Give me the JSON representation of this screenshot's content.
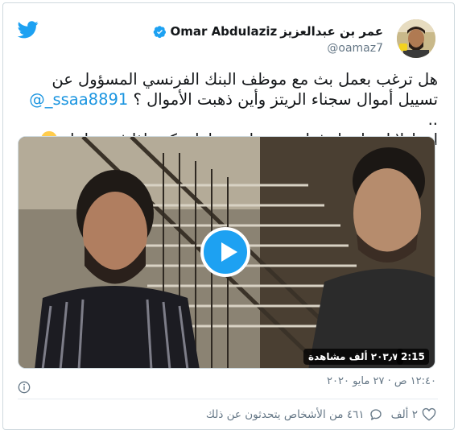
{
  "header": {
    "display_name_ar": "عمر بن عبدالعزيز",
    "display_name_en": "Omar Abdulaziz",
    "handle": "@oamaz7",
    "verified": true,
    "brand_icon": "twitter-bird-icon",
    "brand_color": "#1da1f2"
  },
  "tweet": {
    "line1": "هل ترغب بعمل بث مع موظف البنك الفرنسي المسؤول عن",
    "line2_text": "تسييل أموال سجناء الريتز وأين ذهبت الأموال ؟",
    "line2_mention": "@_ssaa8891",
    "line2_tail": "..",
    "line3": "اعط لايك واعمل فولو ونضبط معه لقاء بكرة اذا فيه تفاعل",
    "emoji": "smiling-face-with-sunglasses-icon"
  },
  "media": {
    "views": "٢٠٣٫٧ ألف مشاهدة",
    "duration": "2:15",
    "play_icon": "play-icon"
  },
  "meta": {
    "timestamp": "١٢:٤٠ ص · ٢٧ مايو ٢٠٢٠"
  },
  "actions": {
    "likes": "٢ ألف",
    "replies": "٤٦١ من الأشخاص يتحدثون عن ذلك"
  },
  "colors": {
    "text": "#14171a",
    "secondary": "#657786",
    "link": "#1b95e0",
    "border": "#cfd9de"
  }
}
